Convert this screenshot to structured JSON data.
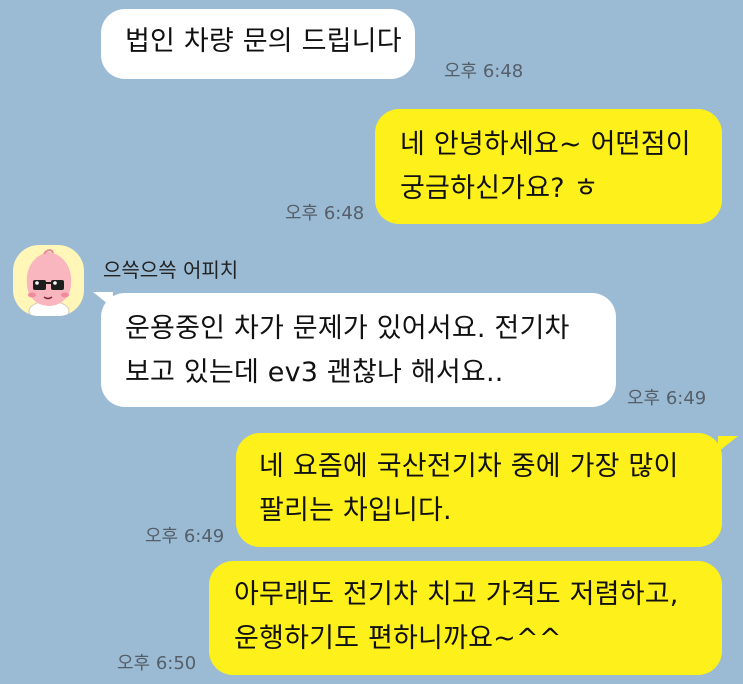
{
  "colors": {
    "background": "#9bbbd4",
    "incoming_bubble": "#ffffff",
    "outgoing_bubble": "#fef01b"
  },
  "messages": [
    {
      "direction": "incoming",
      "lines": [
        "법인 차량 문의 드립니다"
      ],
      "time": "오후 6:48"
    },
    {
      "direction": "outgoing",
      "lines": [
        "네 안녕하세요~ 어떤점이",
        "궁금하신가요? ㅎ"
      ],
      "time": "오후 6:48"
    },
    {
      "direction": "incoming",
      "sender": "으쓱으쓱 어피치",
      "avatar_icon": "peach-character-icon",
      "lines": [
        "운용중인 차가 문제가 있어서요. 전기차",
        "보고 있는데 ev3 괜찮나 해서요.."
      ],
      "time": "오후 6:49"
    },
    {
      "direction": "outgoing",
      "lines": [
        "네 요즘에 국산전기차 중에 가장 많이",
        "팔리는 차입니다."
      ],
      "time": "오후 6:49"
    },
    {
      "direction": "outgoing",
      "lines": [
        "아무래도 전기차 치고 가격도 저렴하고,",
        "운행하기도 편하니까요~^^"
      ],
      "time": "오후 6:50"
    }
  ]
}
